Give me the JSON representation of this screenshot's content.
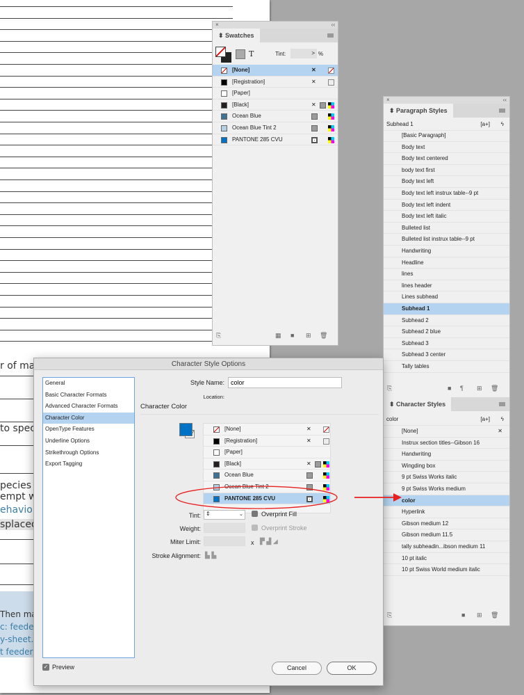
{
  "document": {
    "fragments": [
      "r of mam",
      "to specie",
      "pecies (bir",
      "empt wa",
      "ehavior",
      "splaced"
    ],
    "box_lines": [
      "Then mak",
      "c: feederw",
      "y-sheet.",
      "t feederw"
    ],
    "link_color": "#3a7fa8"
  },
  "swatches": {
    "tab": "Swatches",
    "tint_label": "Tint:",
    "tint_unit": "%",
    "tint_arrow": ">",
    "items": [
      {
        "name": "[None]",
        "color": "none",
        "selected": true,
        "icons": [
          "no-edit",
          "none"
        ]
      },
      {
        "name": "[Registration]",
        "color": "#000000",
        "icons": [
          "no-edit",
          "registration"
        ]
      },
      {
        "name": "[Paper]",
        "color": "#ffffff",
        "icons": []
      },
      {
        "name": "[Black]",
        "color": "#231f20",
        "icons": [
          "no-edit",
          "process",
          "cmyk"
        ]
      },
      {
        "name": "Ocean Blue",
        "color": "#3f7396",
        "icons": [
          "process",
          "cmyk"
        ]
      },
      {
        "name": "Ocean Blue Tint 2",
        "color": "#b5cfe2",
        "icons": [
          "process",
          "cmyk"
        ]
      },
      {
        "name": "PANTONE 285 CVU",
        "color": "#0072c6",
        "icons": [
          "spot",
          "cmyk"
        ]
      }
    ]
  },
  "paragraph_styles": {
    "tab": "Paragraph Styles",
    "current": "Subhead 1",
    "new_group": "[a+]",
    "items": [
      "[Basic Paragraph]",
      "Body text",
      "Body text centered",
      "body text first",
      "Body text left",
      "Body text left instrux table--9 pt",
      "Body text left indent",
      "Body text left italic",
      "Bulleted list",
      "Bulleted list instrux table--9 pt",
      "Handwriting",
      "Headline",
      "lines",
      "lines header",
      "Lines subhead",
      "Subhead 1",
      "Subhead 2",
      "Subhead 2 blue",
      "Subhead 3",
      "Subhead 3 center",
      "Tally tables"
    ],
    "selected": "Subhead 1"
  },
  "character_styles": {
    "tab": "Character Styles",
    "current": "color",
    "new_group": "[a+]",
    "items": [
      "[None]",
      "Instrux section titles--Gibson 16",
      "Handwriting",
      "Wingding box",
      "9 pt Swiss Works italic",
      "9 pt Swiss Works medium",
      "color",
      "Hyperlink",
      "Gibson medium 12",
      "Gibson medium 11.5",
      "tally subheadin...ibson medium 11",
      "10 pt italic",
      "10 pt Swiss World medium italic"
    ],
    "selected": "color"
  },
  "dialog": {
    "title": "Character Style Options",
    "categories": [
      "General",
      "Basic Character Formats",
      "Advanced Character Formats",
      "Character Color",
      "OpenType Features",
      "Underline Options",
      "Strikethrough Options",
      "Export Tagging"
    ],
    "selected_category": "Character Color",
    "style_name_label": "Style Name:",
    "style_name": "color",
    "location_label": "Location:",
    "section_title": "Character Color",
    "fill_color": "#0072c6",
    "tint_label": "Tint:",
    "weight_label": "Weight:",
    "miter_label": "Miter Limit:",
    "miter_x": "x",
    "stroke_align_label": "Stroke Alignment:",
    "overprint_fill": "Overprint Fill",
    "overprint_stroke": "Overprint Stroke",
    "preview_label": "Preview",
    "preview_checked": true,
    "cancel": "Cancel",
    "ok": "OK"
  },
  "annotation": {
    "color": "#e8211f"
  }
}
